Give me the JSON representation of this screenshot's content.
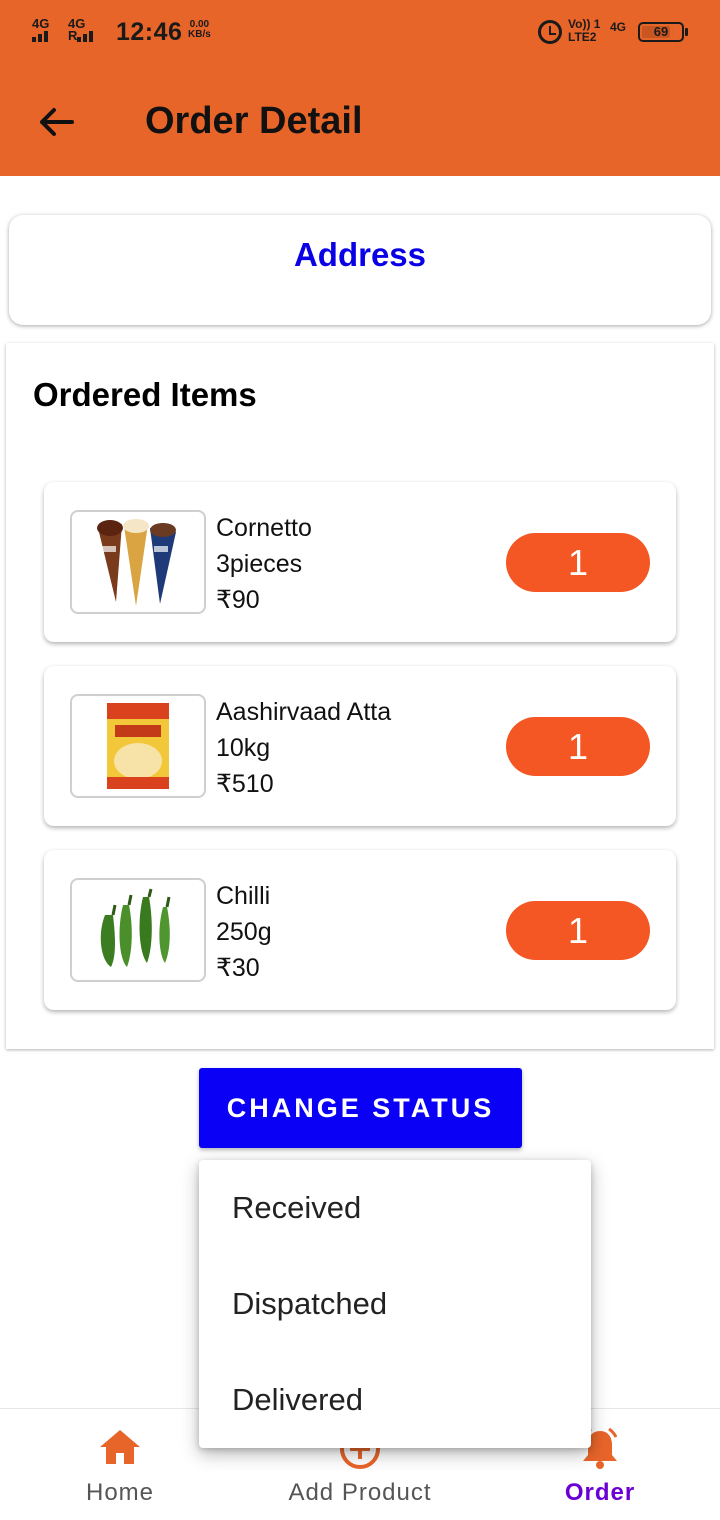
{
  "status_bar": {
    "sig1": "4G",
    "sig2": "4G",
    "sig2_sub": "R",
    "time": "12:46",
    "speed_value": "0.00",
    "speed_unit": "KB/s",
    "volte": "Vo))",
    "lte": "LTE2",
    "sim": "1",
    "net": "4G",
    "battery": "69"
  },
  "header": {
    "title": "Order Detail"
  },
  "address": {
    "title": "Address"
  },
  "ordered_items": {
    "title": "Ordered Items",
    "items": [
      {
        "name": "Cornetto",
        "quantity_label": "3pieces",
        "price": "₹90",
        "count": "1"
      },
      {
        "name": "Aashirvaad Atta",
        "quantity_label": "10kg",
        "price": "₹510",
        "count": "1"
      },
      {
        "name": "Chilli",
        "quantity_label": "250g",
        "price": "₹30",
        "count": "1"
      }
    ]
  },
  "change_status": {
    "label": "CHANGE STATUS"
  },
  "status_menu": {
    "options": [
      "Received",
      "Dispatched",
      "Delivered"
    ]
  },
  "bottom_nav": {
    "items": [
      {
        "label": "Home",
        "icon": "home-icon"
      },
      {
        "label": "Add Product",
        "icon": "add-circle-icon"
      },
      {
        "label": "Order",
        "icon": "bell-icon",
        "active": true
      }
    ]
  },
  "colors": {
    "app_bar": "#E8652A",
    "accent_blue": "#0A00E6",
    "qty_pill": "#F45624",
    "nav_active": "#6A00D4"
  }
}
